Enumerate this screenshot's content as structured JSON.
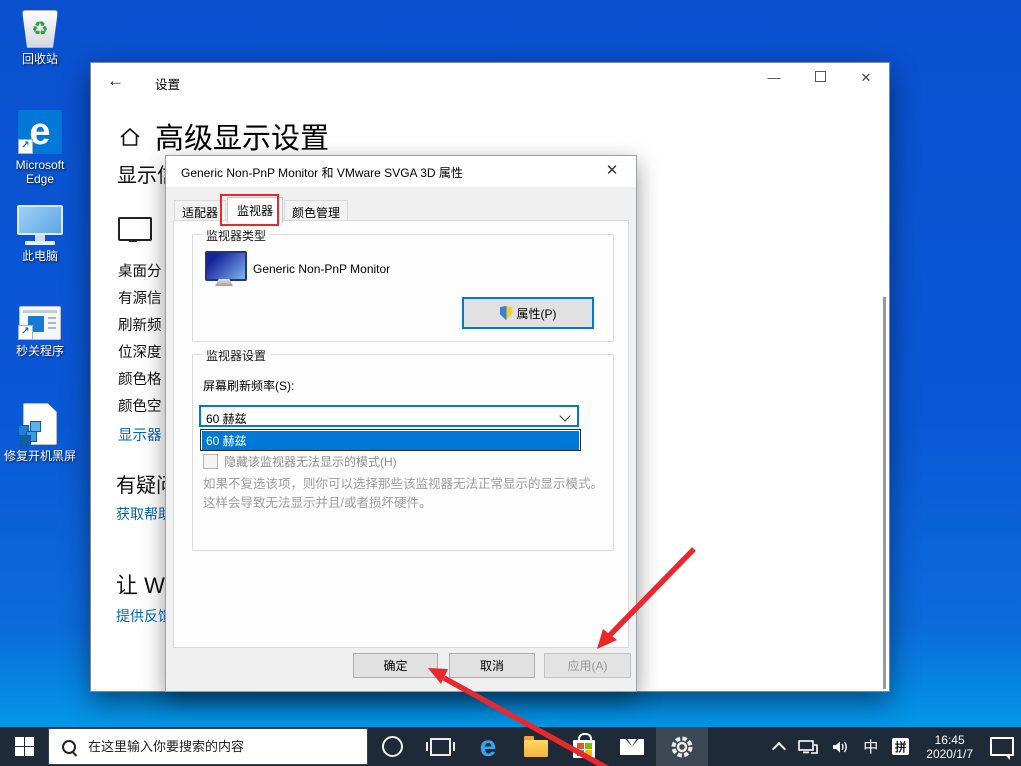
{
  "desktop": {
    "icons": [
      {
        "label": "回收站"
      },
      {
        "label": "Microsoft Edge"
      },
      {
        "label": "此电脑"
      },
      {
        "label": "秒关程序"
      },
      {
        "label": "修复开机黑屏"
      }
    ]
  },
  "settings_window": {
    "title": "设置",
    "heading": "高级显示设置",
    "partial_subheading": "显示信",
    "list_items": [
      "桌面分",
      "有源信",
      "刷新频",
      "位深度",
      "颜色格",
      "颜色空",
      "显示器"
    ],
    "help_heading": "有疑问",
    "help_link": "获取帮助",
    "feedback_heading": "让 Wi",
    "feedback_link": "提供反馈"
  },
  "dialog": {
    "title": "Generic Non-PnP Monitor 和 VMware SVGA 3D 属性",
    "tabs": [
      "适配器",
      "监视器",
      "颜色管理"
    ],
    "active_tab": "监视器",
    "monitor_type_group": {
      "label": "监视器类型",
      "monitor_name": "Generic Non-PnP Monitor",
      "properties_button": "属性(P)"
    },
    "monitor_settings_group": {
      "label": "监视器设置",
      "refresh_label": "屏幕刷新频率(S):",
      "refresh_value": "60 赫兹",
      "dropdown_item": "60 赫兹",
      "checkbox_label": "隐藏该监视器无法显示的模式(H)",
      "warning_line1": "如果不复选该项，则你可以选择那些该监视器无法正常显示的显示模式。",
      "warning_line2": "这样会导致无法显示并且/或者损坏硬件。"
    },
    "buttons": {
      "ok": "确定",
      "cancel": "取消",
      "apply": "应用(A)"
    }
  },
  "taskbar": {
    "search_placeholder": "在这里输入你要搜索的内容",
    "ime_lang": "中",
    "ime_mode": "拼",
    "time": "16:45",
    "date": "2020/1/7"
  },
  "colors": {
    "accent": "#0078d7",
    "annotation_red": "#e8282d",
    "taskbar_bg": "#1e2a38",
    "desktop_blue": "#0a58d6"
  }
}
